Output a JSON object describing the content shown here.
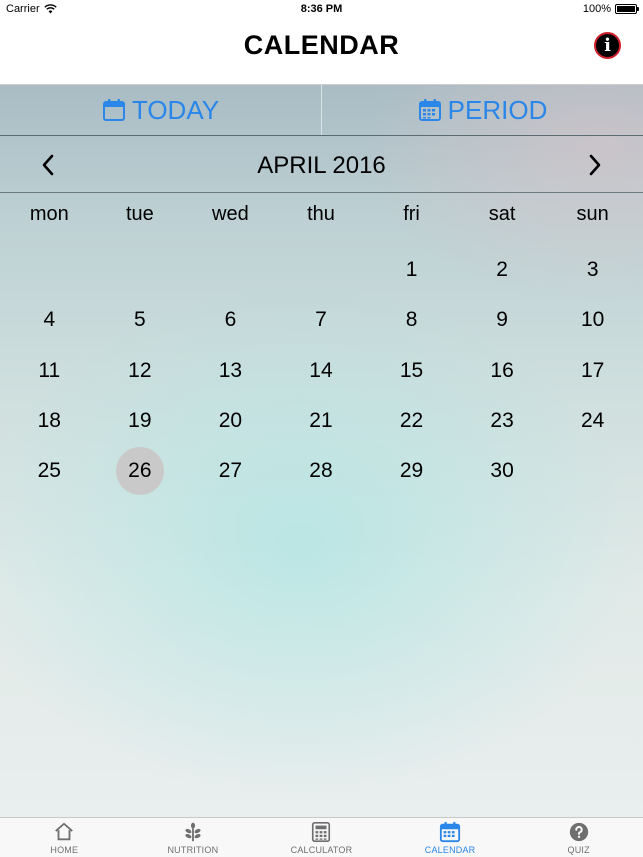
{
  "status_bar": {
    "carrier": "Carrier",
    "time": "8:36 PM",
    "battery": "100%"
  },
  "nav": {
    "title": "CALENDAR",
    "info_glyph": "i"
  },
  "segments": [
    {
      "label": "TODAY",
      "icon": "calendar-icon"
    },
    {
      "label": "PERIOD",
      "icon": "calendar-grid-icon"
    }
  ],
  "calendar": {
    "month_title": "APRIL 2016",
    "weekdays": [
      "mon",
      "tue",
      "wed",
      "thu",
      "fri",
      "sat",
      "sun"
    ],
    "leading_blanks": 4,
    "days": [
      "1",
      "2",
      "3",
      "4",
      "5",
      "6",
      "7",
      "8",
      "9",
      "10",
      "11",
      "12",
      "13",
      "14",
      "15",
      "16",
      "17",
      "18",
      "19",
      "20",
      "21",
      "22",
      "23",
      "24",
      "25",
      "26",
      "27",
      "28",
      "29",
      "30"
    ],
    "highlighted_day": "26"
  },
  "tabs": [
    {
      "label": "HOME",
      "icon": "home-icon",
      "active": false
    },
    {
      "label": "NUTRITION",
      "icon": "plant-icon",
      "active": false
    },
    {
      "label": "CALCULATOR",
      "icon": "calculator-icon",
      "active": false
    },
    {
      "label": "CALENDAR",
      "icon": "calendar-icon",
      "active": true
    },
    {
      "label": "QUIZ",
      "icon": "question-icon",
      "active": false
    }
  ],
  "colors": {
    "accent": "#2a86e8",
    "today_circle": "#c9c9c9",
    "info_ring": "#d0202c"
  }
}
